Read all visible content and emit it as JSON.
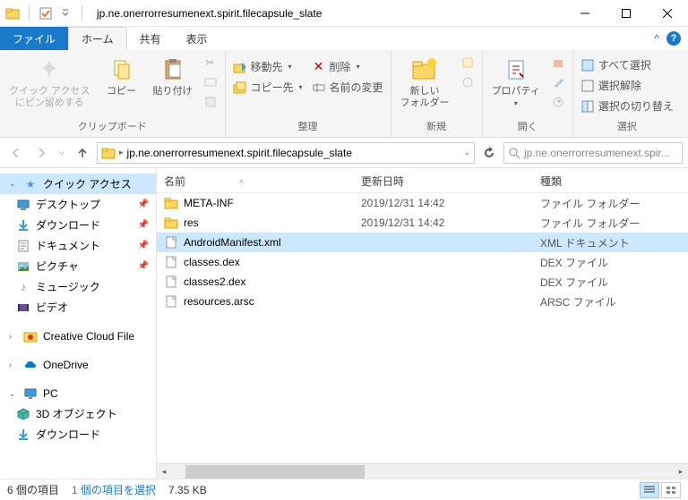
{
  "window": {
    "title": "jp.ne.onerrorresumenext.spirit.filecapsule_slate"
  },
  "tabs": {
    "file": "ファイル",
    "home": "ホーム",
    "share": "共有",
    "view": "表示"
  },
  "ribbon": {
    "clipboard": {
      "pin": "クイック アクセス\nにピン留めする",
      "copy": "コピー",
      "paste": "貼り付け",
      "cut": "切り取り",
      "copypath": "パスのコピー",
      "pasteshortcut": "ショートカットの貼り付け",
      "label": "クリップボード"
    },
    "organize": {
      "moveto": "移動先",
      "delete": "削除",
      "copyto": "コピー先",
      "rename": "名前の変更",
      "label": "整理"
    },
    "new": {
      "newfolder": "新しい\nフォルダー",
      "label": "新規"
    },
    "open": {
      "properties": "プロパティ",
      "label": "開く"
    },
    "select": {
      "selectall": "すべて選択",
      "selectnone": "選択解除",
      "invert": "選択の切り替え",
      "label": "選択"
    }
  },
  "addressbar": {
    "path": "jp.ne.onerrorresumenext.spirit.filecapsule_slate",
    "search_placeholder": "jp.ne.onerrorresumenext.spir..."
  },
  "sidebar": {
    "quickaccess": "クイック アクセス",
    "desktop": "デスクトップ",
    "downloads": "ダウンロード",
    "documents": "ドキュメント",
    "pictures": "ピクチャ",
    "music": "ミュージック",
    "videos": "ビデオ",
    "ccfiles": "Creative Cloud File",
    "onedrive": "OneDrive",
    "pc": "PC",
    "objects3d": "3D オブジェクト",
    "downloads2": "ダウンロード"
  },
  "columns": {
    "name": "名前",
    "modified": "更新日時",
    "type": "種類"
  },
  "rows": [
    {
      "icon": "folder",
      "name": "META-INF",
      "modified": "2019/12/31 14:42",
      "type": "ファイル フォルダー",
      "selected": false
    },
    {
      "icon": "folder",
      "name": "res",
      "modified": "2019/12/31 14:42",
      "type": "ファイル フォルダー",
      "selected": false
    },
    {
      "icon": "file",
      "name": "AndroidManifest.xml",
      "modified": "",
      "type": "XML ドキュメント",
      "selected": true
    },
    {
      "icon": "file",
      "name": "classes.dex",
      "modified": "",
      "type": "DEX ファイル",
      "selected": false
    },
    {
      "icon": "file",
      "name": "classes2.dex",
      "modified": "",
      "type": "DEX ファイル",
      "selected": false
    },
    {
      "icon": "file",
      "name": "resources.arsc",
      "modified": "",
      "type": "ARSC ファイル",
      "selected": false
    }
  ],
  "status": {
    "count": "6 個の項目",
    "selected": "1 個の項目を選択",
    "size": "7.35 KB"
  }
}
